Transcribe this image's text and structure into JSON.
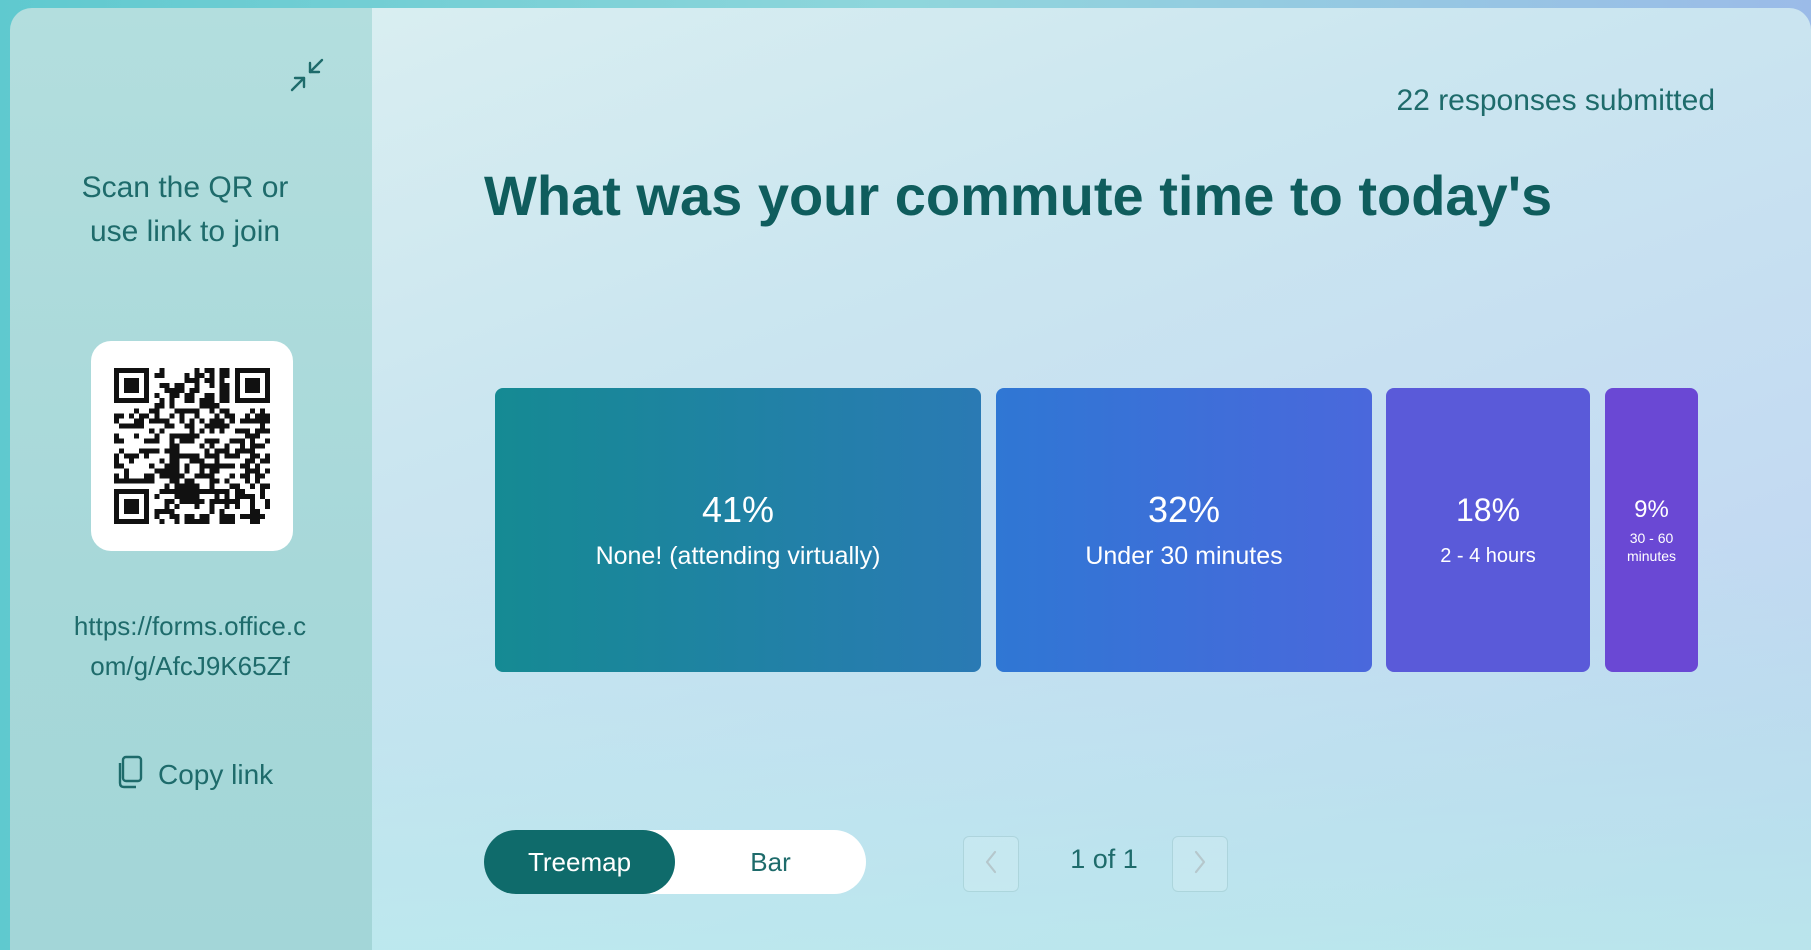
{
  "sidebar": {
    "join_instructions": "Scan the QR or use link to join",
    "link": "https://forms.office.com/g/AfcJ9K65Zf",
    "copy_link_label": "Copy link"
  },
  "header": {
    "responses": "22 responses submitted",
    "question": "What was your commute time to today's"
  },
  "treemap": {
    "tiles": [
      {
        "percent": "41%",
        "label": "None! (attending virtually)",
        "color": "#158a93"
      },
      {
        "percent": "32%",
        "label": "Under 30 minutes",
        "color": "#2f77d4"
      },
      {
        "percent": "18%",
        "label": "2 - 4 hours",
        "color": "#5a5ad9"
      },
      {
        "percent": "9%",
        "label": "30 - 60 minutes",
        "color": "#6a48d4"
      }
    ]
  },
  "view_toggle": {
    "treemap_label": "Treemap",
    "bar_label": "Bar",
    "selected": "Treemap"
  },
  "pager": {
    "page_text": "1 of 1"
  },
  "colors": {
    "accent": "#0f6b6b",
    "text": "#1e6b6b"
  }
}
